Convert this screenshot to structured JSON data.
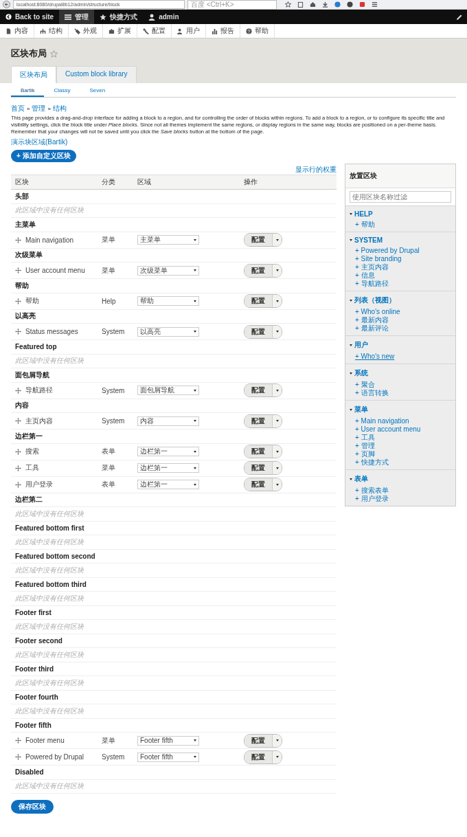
{
  "browser": {
    "url": "localhost:8080/drupal8b12/admin/structure/block",
    "search_placeholder": "百度 <Ctrl+K>"
  },
  "toolbar": {
    "items": [
      {
        "label": "Back to site",
        "selected": false
      },
      {
        "label": "管理",
        "selected": true
      },
      {
        "label": "快捷方式",
        "selected": false
      },
      {
        "label": "admin",
        "selected": false
      }
    ]
  },
  "tray": [
    "内容",
    "结构",
    "外观",
    "扩展",
    "配置",
    "用户",
    "报告",
    "帮助"
  ],
  "page_title": "区块布局",
  "tabs": [
    {
      "label": "区块布局",
      "selected": true
    },
    {
      "label": "Custom block library",
      "selected": false
    }
  ],
  "theme_tabs": [
    {
      "label": "Bartik",
      "selected": true
    },
    {
      "label": "Classy",
      "selected": false
    },
    {
      "label": "Seven",
      "selected": false
    }
  ],
  "breadcrumb": {
    "items": [
      "首页",
      "管理",
      "结构"
    ],
    "separators": [
      "»",
      "»"
    ]
  },
  "description": "This page provides a drag-and-drop interface for adding a block to a region, and for controlling the order of blocks within regions. To add a block to a region, or to configure its specific title and visibility settings, click the block title under *Place blocks*. Since not all themes implement the same regions, or display regions in the same way, blocks are positioned on a per-theme basis. Remember that your changes will not be saved until you click the *Save blocks* button at the bottom of the page.",
  "demo_link": "演示块区域(Bartik)",
  "add_button": "+ 添加自定义区块",
  "weights_link": "显示行的权重",
  "table": {
    "columns": [
      "区块",
      "分类",
      "区域",
      "操作"
    ],
    "regions": [
      {
        "name": "头部",
        "empty_text": "此区域中没有任何区块"
      },
      {
        "name": "主菜单",
        "blocks": [
          {
            "title": "Main navigation",
            "category": "菜单",
            "region": "主菜单",
            "action": "配置"
          }
        ]
      },
      {
        "name": "次级菜单",
        "blocks": [
          {
            "title": "User account menu",
            "category": "菜单",
            "region": "次级菜单",
            "action": "配置"
          }
        ]
      },
      {
        "name": "帮助",
        "blocks": [
          {
            "title": "帮助",
            "category": "Help",
            "region": "帮助",
            "action": "配置"
          }
        ]
      },
      {
        "name": "以高亮",
        "blocks": [
          {
            "title": "Status messages",
            "category": "System",
            "region": "以高亮",
            "action": "配置"
          }
        ]
      },
      {
        "name": "Featured top",
        "empty_text": "此区域中没有任何区块"
      },
      {
        "name": "面包屑导航",
        "blocks": [
          {
            "title": "导航路径",
            "category": "System",
            "region": "面包屑导航",
            "action": "配置"
          }
        ]
      },
      {
        "name": "内容",
        "blocks": [
          {
            "title": "主页内容",
            "category": "System",
            "region": "内容",
            "action": "配置"
          }
        ]
      },
      {
        "name": "边栏第一",
        "blocks": [
          {
            "title": "搜索",
            "category": "表单",
            "region": "边栏第一",
            "action": "配置"
          },
          {
            "title": "工具",
            "category": "菜单",
            "region": "边栏第一",
            "action": "配置"
          },
          {
            "title": "用户登录",
            "category": "表单",
            "region": "边栏第一",
            "action": "配置"
          }
        ]
      },
      {
        "name": "边栏第二",
        "empty_text": "此区域中没有任何区块"
      },
      {
        "name": "Featured bottom first",
        "empty_text": "此区域中没有任何区块"
      },
      {
        "name": "Featured bottom second",
        "empty_text": "此区域中没有任何区块"
      },
      {
        "name": "Featured bottom third",
        "empty_text": "此区域中没有任何区块"
      },
      {
        "name": "Footer first",
        "empty_text": "此区域中没有任何区块"
      },
      {
        "name": "Footer second",
        "empty_text": "此区域中没有任何区块"
      },
      {
        "name": "Footer third",
        "empty_text": "此区域中没有任何区块"
      },
      {
        "name": "Footer fourth",
        "empty_text": "此区域中没有任何区块"
      },
      {
        "name": "Footer fifth",
        "blocks": [
          {
            "title": "Footer menu",
            "category": "菜单",
            "region": "Footer fifth",
            "action": "配置"
          },
          {
            "title": "Powered by Drupal",
            "category": "System",
            "region": "Footer fifth",
            "action": "配置"
          }
        ]
      },
      {
        "name": "Disabled",
        "empty_text": "此区域中没有任何区块"
      }
    ]
  },
  "save_button": "保存区块",
  "place_blocks": {
    "title": "放置区块",
    "filter_placeholder": "使用区块名称过滤",
    "sections": [
      {
        "name": "HELP",
        "expanded": true,
        "items": [
          {
            "label": "+ 帮助",
            "focused": false
          }
        ]
      },
      {
        "name": "SYSTEM",
        "expanded": true,
        "items": [
          {
            "label": "+ Powered by Drupal",
            "focused": false
          },
          {
            "label": "+ Site branding",
            "focused": false
          },
          {
            "label": "+ 主页内容",
            "focused": false
          },
          {
            "label": "+ 信息",
            "focused": false
          },
          {
            "label": "+ 导航路径",
            "focused": false
          }
        ]
      },
      {
        "name": "列表（视图）",
        "expanded": true,
        "items": [
          {
            "label": "+ Who's online",
            "focused": false
          },
          {
            "label": "+ 最新内容",
            "focused": false
          },
          {
            "label": "+ 最新评论",
            "focused": false
          }
        ]
      },
      {
        "name": "用户",
        "expanded": true,
        "items": [
          {
            "label": "+ Who's new",
            "focused": true
          }
        ]
      },
      {
        "name": "系统",
        "expanded": true,
        "items": [
          {
            "label": "+ 聚合",
            "focused": false
          },
          {
            "label": "+ 语言转换",
            "focused": false
          }
        ]
      },
      {
        "name": "菜单",
        "expanded": true,
        "items": [
          {
            "label": "+ Main navigation",
            "focused": false
          },
          {
            "label": "+ User account menu",
            "focused": false
          },
          {
            "label": "+ 工具",
            "focused": false
          },
          {
            "label": "+ 管理",
            "focused": false
          },
          {
            "label": "+ 页脚",
            "focused": false
          },
          {
            "label": "+ 快捷方式",
            "focused": false
          }
        ]
      },
      {
        "name": "表单",
        "expanded": true,
        "items": [
          {
            "label": "+ 搜索表单",
            "focused": false
          },
          {
            "label": "+ 用户登录",
            "focused": false
          }
        ]
      }
    ]
  }
}
